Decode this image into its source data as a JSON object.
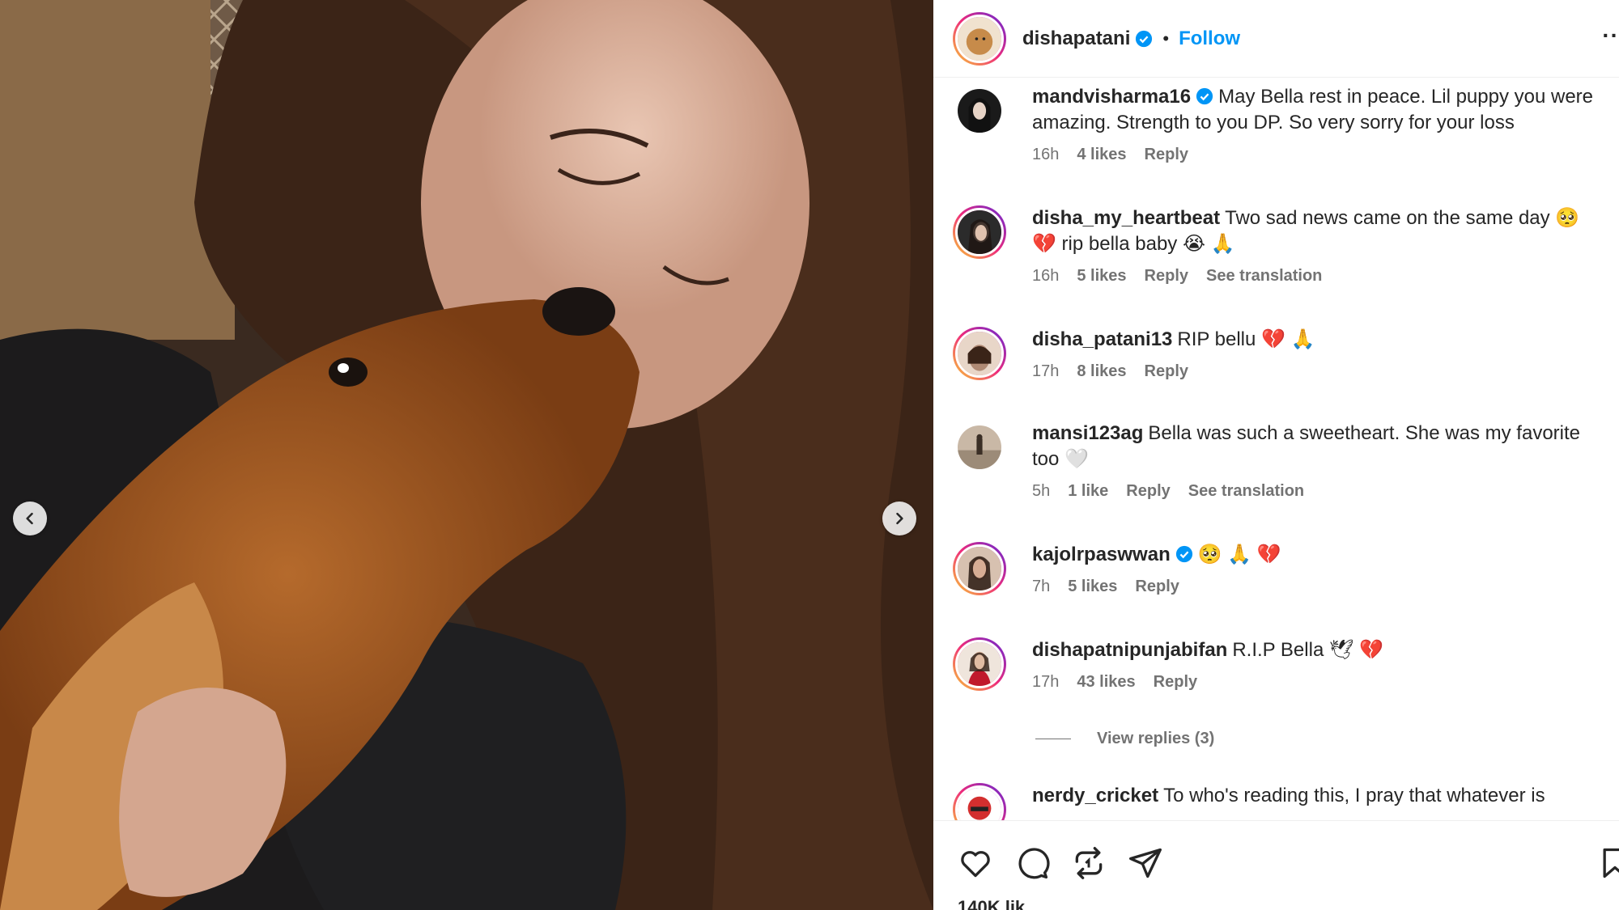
{
  "header": {
    "username": "dishapatani",
    "separator": "•",
    "follow_label": "Follow",
    "more_label": "··"
  },
  "comments": [
    {
      "user": "mandvisharma16",
      "verified": true,
      "text": "May Bella rest in peace. Lil puppy you were amazing. Strength to you DP. So very sorry for your loss",
      "time": "16h",
      "likes": "4 likes",
      "reply": "Reply",
      "translation": ""
    },
    {
      "user": "disha_my_heartbeat",
      "verified": false,
      "text": "Two sad news came on the same day 🥺 💔 rip bella baby 😭 🙏",
      "time": "16h",
      "likes": "5 likes",
      "reply": "Reply",
      "translation": "See translation"
    },
    {
      "user": "disha_patani13",
      "verified": false,
      "text": "RIP bellu 💔 🙏",
      "time": "17h",
      "likes": "8 likes",
      "reply": "Reply",
      "translation": ""
    },
    {
      "user": "mansi123ag",
      "verified": false,
      "text": "Bella was such a sweetheart. She was my favorite too 🤍",
      "time": "5h",
      "likes": "1 like",
      "reply": "Reply",
      "translation": "See translation"
    },
    {
      "user": "kajolrpaswwan",
      "verified": true,
      "text": "🥺 🙏 💔",
      "time": "7h",
      "likes": "5 likes",
      "reply": "Reply",
      "translation": ""
    },
    {
      "user": "dishapatnipunjabifan",
      "verified": false,
      "text": "R.I.P Bella 🕊 💔",
      "time": "17h",
      "likes": "43 likes",
      "reply": "Reply",
      "translation": ""
    },
    {
      "user": "nerdy_cricket",
      "verified": false,
      "text": "To who's reading this, I pray that whatever is",
      "time": "",
      "likes": "",
      "reply": "",
      "translation": ""
    }
  ],
  "view_replies_label": "View replies (3)",
  "likes_partial": "140K lik",
  "icons": {
    "prev": "chevron-left-icon",
    "next": "chevron-right-icon",
    "like": "heart-icon",
    "comment": "comment-icon",
    "share": "repost-icon",
    "send": "send-icon",
    "save": "bookmark-icon"
  },
  "colors": {
    "follow": "#0095f6",
    "verified": "#0095f6",
    "meta": "#737373"
  }
}
